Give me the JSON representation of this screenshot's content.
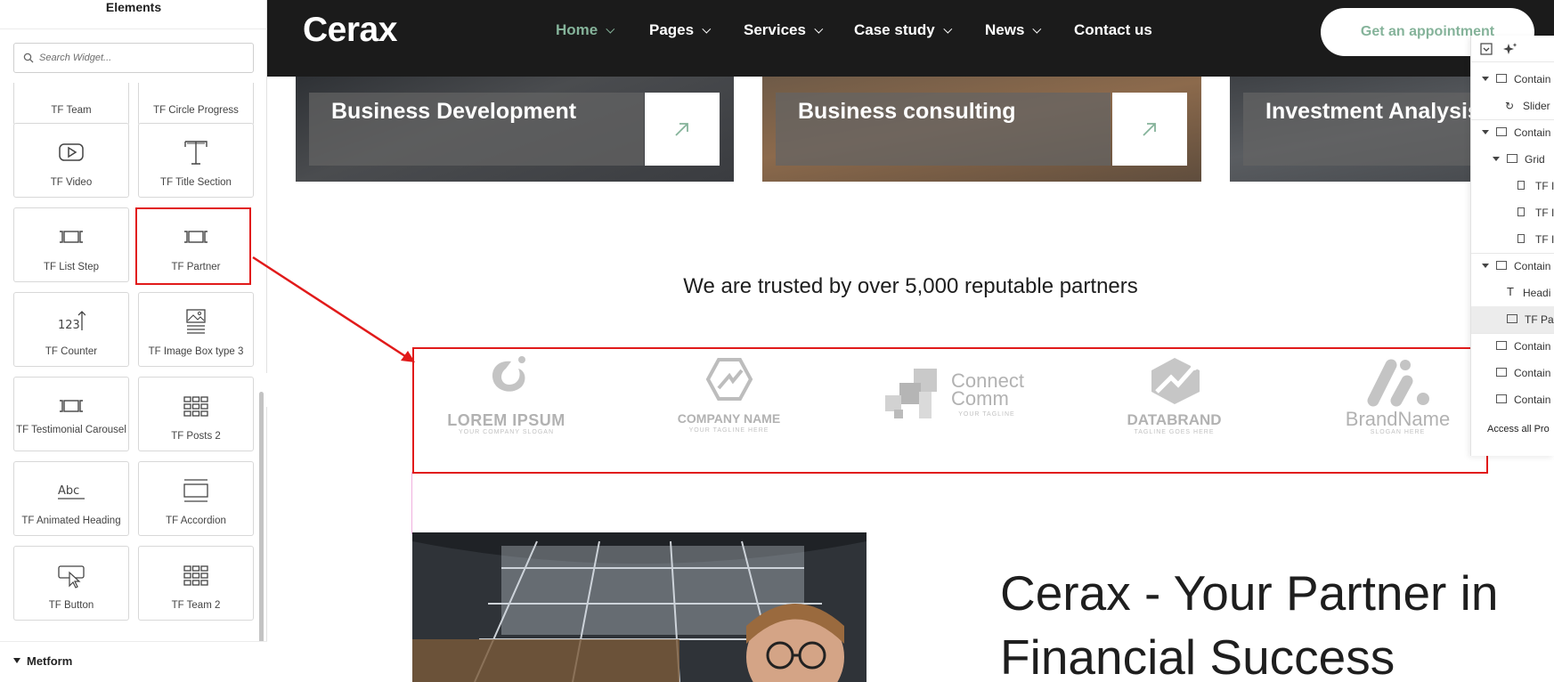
{
  "panel": {
    "title": "Elements",
    "search_placeholder": "Search Widget...",
    "tiles": [
      {
        "label": "TF Team",
        "icon": "team-icon"
      },
      {
        "label": "TF Circle Progress",
        "icon": "circle-progress-icon"
      },
      {
        "label": "TF Video",
        "icon": "video-play-icon"
      },
      {
        "label": "TF Title Section",
        "icon": "title-text-icon"
      },
      {
        "label": "TF List Step",
        "icon": "carousel-icon"
      },
      {
        "label": "TF Partner",
        "icon": "carousel-icon"
      },
      {
        "label": "TF Counter",
        "icon": "counter-icon"
      },
      {
        "label": "TF Image Box type 3",
        "icon": "image-box-icon"
      },
      {
        "label": "TF Testimonial Carousel",
        "icon": "carousel-icon"
      },
      {
        "label": "TF Posts 2",
        "icon": "posts-grid-icon"
      },
      {
        "label": "TF Animated Heading",
        "icon": "animated-heading-icon"
      },
      {
        "label": "TF Accordion",
        "icon": "accordion-icon"
      },
      {
        "label": "TF Button",
        "icon": "button-cursor-icon"
      },
      {
        "label": "TF Team 2",
        "icon": "team-grid-icon"
      }
    ],
    "collapse_glyph": "‹",
    "category": "Metform"
  },
  "site": {
    "logo": "Cerax",
    "nav": [
      {
        "label": "Home",
        "active": true
      },
      {
        "label": "Pages",
        "active": false
      },
      {
        "label": "Services",
        "active": false
      },
      {
        "label": "Case study",
        "active": false
      },
      {
        "label": "News",
        "active": false
      },
      {
        "label": "Contact us",
        "active": false
      }
    ],
    "cta": "Get an appointment",
    "services": [
      "Business Development",
      "Business consulting",
      "Investment Analysis"
    ],
    "trusted_heading": "We are trusted by over 5,000 reputable partners",
    "partners": [
      {
        "name": "LOREM IPSUM",
        "tagline": "YOUR COMPANY SLOGAN"
      },
      {
        "name": "COMPANY NAME",
        "tagline": "YOUR TAGLINE HERE"
      },
      {
        "name_line1": "Connect",
        "name_line2": "Comm",
        "tagline": "YOUR TAGLINE"
      },
      {
        "name": "DATABRAND",
        "tagline": "TAGLINE GOES HERE"
      },
      {
        "name": "BrandName",
        "tagline": "SLOGAN HERE"
      }
    ],
    "hero_title": "Cerax - Your Partner in Financial Success"
  },
  "navigator": {
    "rows": [
      "Contain",
      "Slider",
      "Contain",
      "Grid",
      "TF I",
      "TF I",
      "TF I",
      "Contain",
      "Headi",
      "TF Pa",
      "Contain",
      "Contain",
      "Contain"
    ],
    "access": "Access all Pro"
  },
  "colors": {
    "accent_green": "#85b39a",
    "dark_nav": "#1b1b1b",
    "highlight_red": "#e11a1a"
  }
}
